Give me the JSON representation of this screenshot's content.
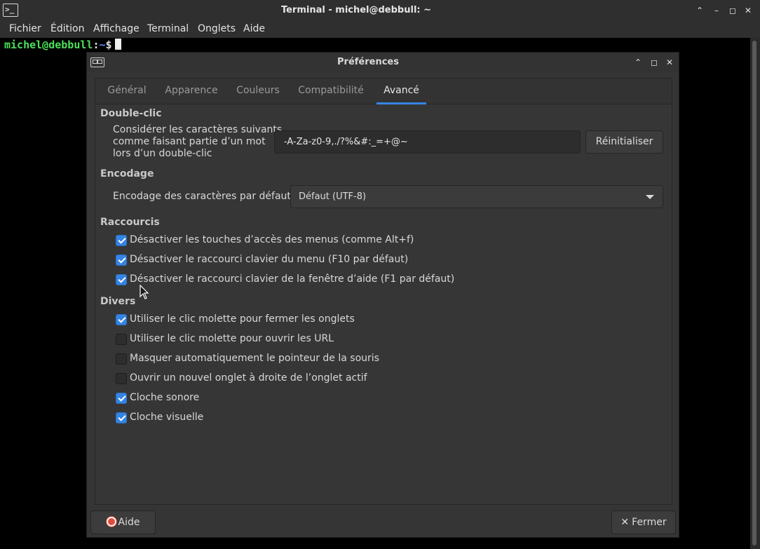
{
  "terminal": {
    "title": "Terminal - michel@debbull: ~",
    "app_icon": ">_",
    "menu": [
      "Fichier",
      "Édition",
      "Affichage",
      "Terminal",
      "Onglets",
      "Aide"
    ],
    "prompt": {
      "user_host": "michel@debbull",
      "colon": ":",
      "path": "~",
      "dollar": "$"
    },
    "window_controls": [
      "chevron-up-icon",
      "minimize-icon",
      "maximize-icon",
      "close-icon"
    ]
  },
  "dialog": {
    "title": "Préférences",
    "tabs": [
      {
        "label": "Général",
        "active": false
      },
      {
        "label": "Apparence",
        "active": false
      },
      {
        "label": "Couleurs",
        "active": false
      },
      {
        "label": "Compatibilité",
        "active": false
      },
      {
        "label": "Avancé",
        "active": true
      }
    ],
    "double_click": {
      "section": "Double-clic",
      "label_lines": [
        "Considérer les caractères suivants",
        "comme faisant partie d’un mot",
        "lors d’un double-clic"
      ],
      "value": "-A-Za-z0-9,./?%&#:_=+@~",
      "reset_label": "Réinitialiser"
    },
    "encoding": {
      "section": "Encodage",
      "label": "Encodage des caractères par défaut :",
      "value": "Défaut (UTF-8)"
    },
    "shortcuts": {
      "section": "Raccourcis",
      "items": [
        {
          "label": "Désactiver les touches d’accès des menus (comme Alt+f)",
          "checked": true
        },
        {
          "label": "Désactiver le raccourci clavier du menu (F10 par défaut)",
          "checked": true
        },
        {
          "label": "Désactiver le raccourci clavier de la fenêtre d’aide (F1 par défaut)",
          "checked": true
        }
      ]
    },
    "misc": {
      "section": "Divers",
      "items": [
        {
          "label": "Utiliser le clic molette pour fermer les onglets",
          "checked": true
        },
        {
          "label": "Utiliser le clic molette pour ouvrir les URL",
          "checked": false
        },
        {
          "label": "Masquer automatiquement le pointeur de la souris",
          "checked": false
        },
        {
          "label": "Ouvrir un nouvel onglet à droite de l’onglet actif",
          "checked": false
        },
        {
          "label": "Cloche sonore",
          "checked": true
        },
        {
          "label": "Cloche visuelle",
          "checked": true
        }
      ]
    },
    "help_label": "Aide",
    "close_label": "Fermer",
    "accent_color": "#3584e4"
  }
}
